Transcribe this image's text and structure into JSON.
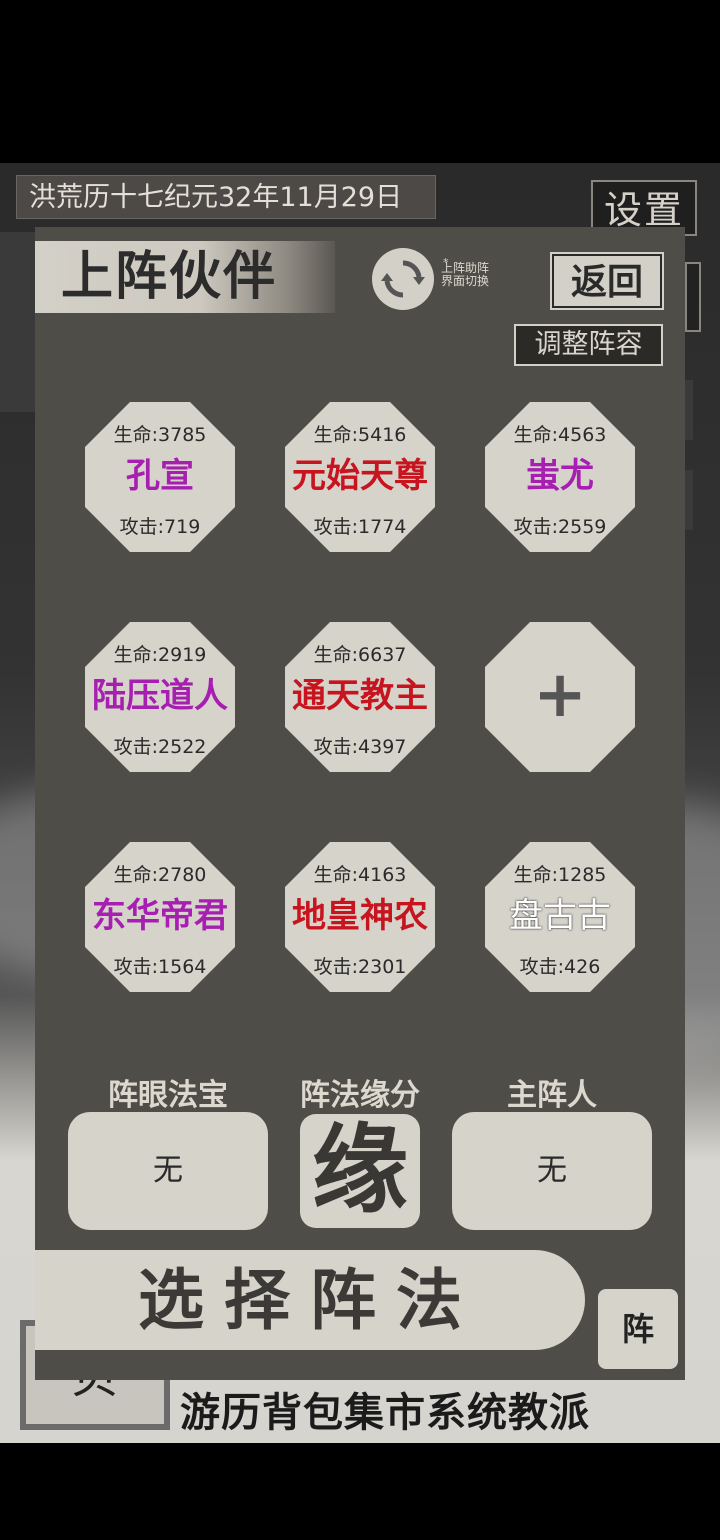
{
  "header": {
    "date": "洪荒历十七纪元32年11月29日",
    "settings_label": "设置"
  },
  "panel": {
    "title": "上阵伙伴",
    "switch_note_star": "*",
    "switch_note_line1": "上阵助阵",
    "switch_note_line2": "界面切换",
    "back_label": "返回",
    "adjust_label": "调整阵容"
  },
  "partners": [
    {
      "hp": "生命:3785",
      "name": "孔宣",
      "atk": "攻击:719",
      "color": "#a61fb0"
    },
    {
      "hp": "生命:5416",
      "name": "元始天尊",
      "atk": "攻击:1774",
      "color": "#c8141e"
    },
    {
      "hp": "生命:4563",
      "name": "蚩尤",
      "atk": "攻击:2559",
      "color": "#a61fb0"
    },
    {
      "hp": "生命:2919",
      "name": "陆压道人",
      "atk": "攻击:2522",
      "color": "#a61fb0"
    },
    {
      "hp": "生命:6637",
      "name": "通天教主",
      "atk": "攻击:4397",
      "color": "#c8141e"
    },
    {
      "empty": true,
      "plus": "+"
    },
    {
      "hp": "生命:2780",
      "name": "东华帝君",
      "atk": "攻击:1564",
      "color": "#a61fb0"
    },
    {
      "hp": "生命:4163",
      "name": "地皇神农",
      "atk": "攻击:2301",
      "color": "#c8141e"
    },
    {
      "hp": "生命:1285",
      "name": "盘古古",
      "atk": "攻击:426",
      "color": "#ffffff"
    }
  ],
  "formation": {
    "treasure_label": "阵眼法宝",
    "treasure_value": "无",
    "bond_label": "阵法缘分",
    "bond_glyph": "缘",
    "master_label": "主阵人",
    "master_value": "无",
    "select_label": "选择阵法",
    "zhen_label": "阵"
  },
  "background": {
    "bottom_tabs": "游历背包集市系统教派",
    "emblem": "贝"
  }
}
